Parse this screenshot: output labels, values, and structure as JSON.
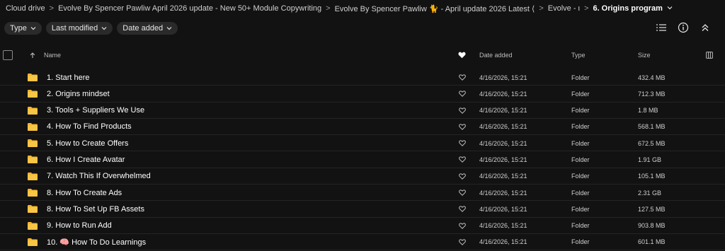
{
  "breadcrumb": [
    "Cloud drive",
    "Evolve By Spencer Pawliw April 2026 update - New 50+ Module Copywriting",
    "Evolve By Spencer Pawliw 🐈 - April update 2026 Latest ⟨",
    "Evolve - ι",
    "6. Origins program"
  ],
  "filters": [
    "Type",
    "Last modified",
    "Date added"
  ],
  "toolbar_icons": [
    "list-view-icon",
    "info-icon",
    "collapse-icon"
  ],
  "table": {
    "headers": {
      "name": "Name",
      "date_added": "Date added",
      "type": "Type",
      "size": "Size"
    },
    "rows": [
      {
        "name": "1. Start here",
        "date": "4/16/2026, 15:21",
        "type": "Folder",
        "size": "432.4 MB"
      },
      {
        "name": "2. Origins mindset",
        "date": "4/16/2026, 15:21",
        "type": "Folder",
        "size": "712.3 MB"
      },
      {
        "name": "3. Tools + Suppliers We Use",
        "date": "4/16/2026, 15:21",
        "type": "Folder",
        "size": "1.8 MB"
      },
      {
        "name": "4. How To Find Products",
        "date": "4/16/2026, 15:21",
        "type": "Folder",
        "size": "568.1 MB"
      },
      {
        "name": "5. How to Create Offers",
        "date": "4/16/2026, 15:21",
        "type": "Folder",
        "size": "672.5 MB"
      },
      {
        "name": "6. How I Create Avatar",
        "date": "4/16/2026, 15:21",
        "type": "Folder",
        "size": "1.91 GB"
      },
      {
        "name": "7. Watch This If Overwhelmed",
        "date": "4/16/2026, 15:21",
        "type": "Folder",
        "size": "105.1 MB"
      },
      {
        "name": "8. How To Create Ads",
        "date": "4/16/2026, 15:21",
        "type": "Folder",
        "size": "2.31 GB"
      },
      {
        "name": "8. How To Set Up FB Assets",
        "date": "4/16/2026, 15:21",
        "type": "Folder",
        "size": "127.5 MB"
      },
      {
        "name": "9. How to Run Add",
        "date": "4/16/2026, 15:21",
        "type": "Folder",
        "size": "903.8 MB"
      },
      {
        "name": "10. 🧠 How To Do Learnings",
        "date": "4/16/2026, 15:21",
        "type": "Folder",
        "size": "601.1 MB"
      }
    ]
  },
  "colors": {
    "background": "#121212",
    "folder": "#f5b52e",
    "chip": "#2a2a2a"
  }
}
